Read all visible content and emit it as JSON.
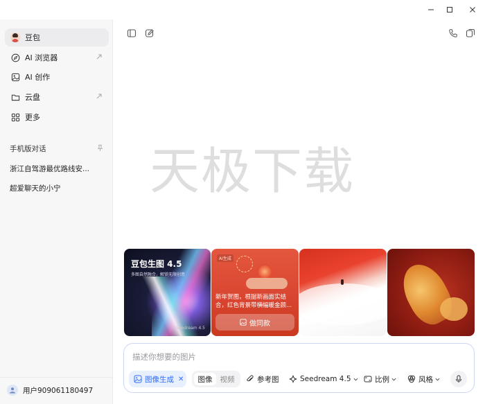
{
  "sidebar": {
    "nav": [
      {
        "label": "豆包",
        "icon": "avatar-icon",
        "active": true
      },
      {
        "label": "AI 浏览器",
        "icon": "compass-icon",
        "external": true
      },
      {
        "label": "AI 创作",
        "icon": "image-icon"
      },
      {
        "label": "云盘",
        "icon": "folder-icon",
        "external": true
      },
      {
        "label": "更多",
        "icon": "grid-icon"
      }
    ],
    "section_title": "手机版对话",
    "conversations": [
      "浙江自驾游最优路线安...",
      "超爱聊天的小宁"
    ],
    "user_name": "用户909061180497"
  },
  "main": {
    "watermark": "天极下载",
    "cards": {
      "card1_title": "豆包生图 4.5",
      "card1_subtitle": "多图自然融合，解锁无限创意",
      "card1_tag": "Seedream 4.5",
      "card2_tag": "AI生成",
      "card2_text": "新年贺图，根据新画面实结合，红色背景带横幅暖金颜...",
      "card2_button": "做同款"
    },
    "input": {
      "placeholder": "描述你想要的图片",
      "mode_chip": "图像生成",
      "segment_image": "图像",
      "segment_video": "视频",
      "reference": "参考图",
      "model": "Seedream 4.5",
      "ratio": "比例",
      "style": "风格"
    }
  },
  "colors": {
    "accent": "#2f6bff",
    "chip_bg": "#e8f0fe",
    "sidebar_bg": "#f7f7f8",
    "watermark": "#dedede"
  }
}
